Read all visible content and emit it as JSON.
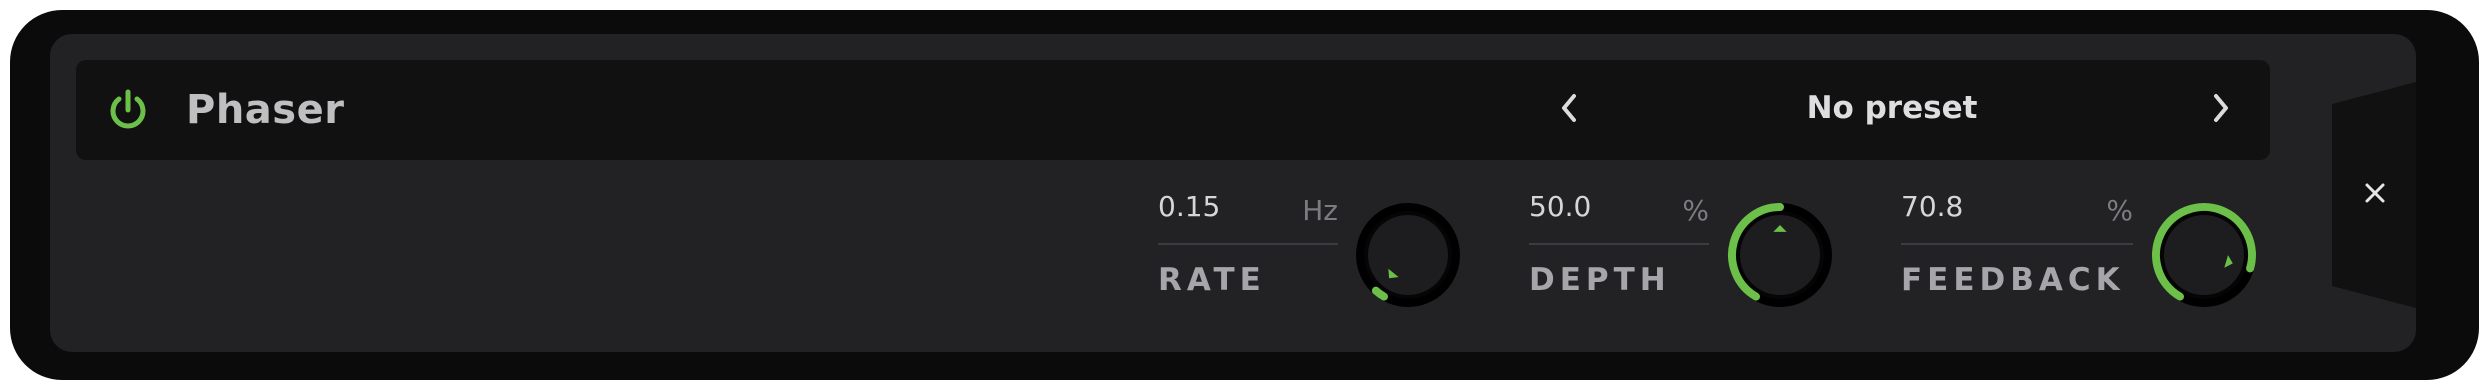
{
  "plugin": {
    "name": "Phaser",
    "enabled": true,
    "power_icon": "power-icon",
    "accent_color": "#6cc04a"
  },
  "preset": {
    "label": "No preset",
    "prev_icon": "chevron-left-icon",
    "next_icon": "chevron-right-icon"
  },
  "controls": [
    {
      "id": "rate",
      "label": "RATE",
      "value": "0.15",
      "unit": "Hz",
      "level": 0.03
    },
    {
      "id": "depth",
      "label": "DEPTH",
      "value": "50.0",
      "unit": "%",
      "level": 0.5
    },
    {
      "id": "feedback",
      "label": "FEEDBACK",
      "value": "70.8",
      "unit": "%",
      "level": 0.854
    }
  ],
  "close_icon": "close-icon"
}
